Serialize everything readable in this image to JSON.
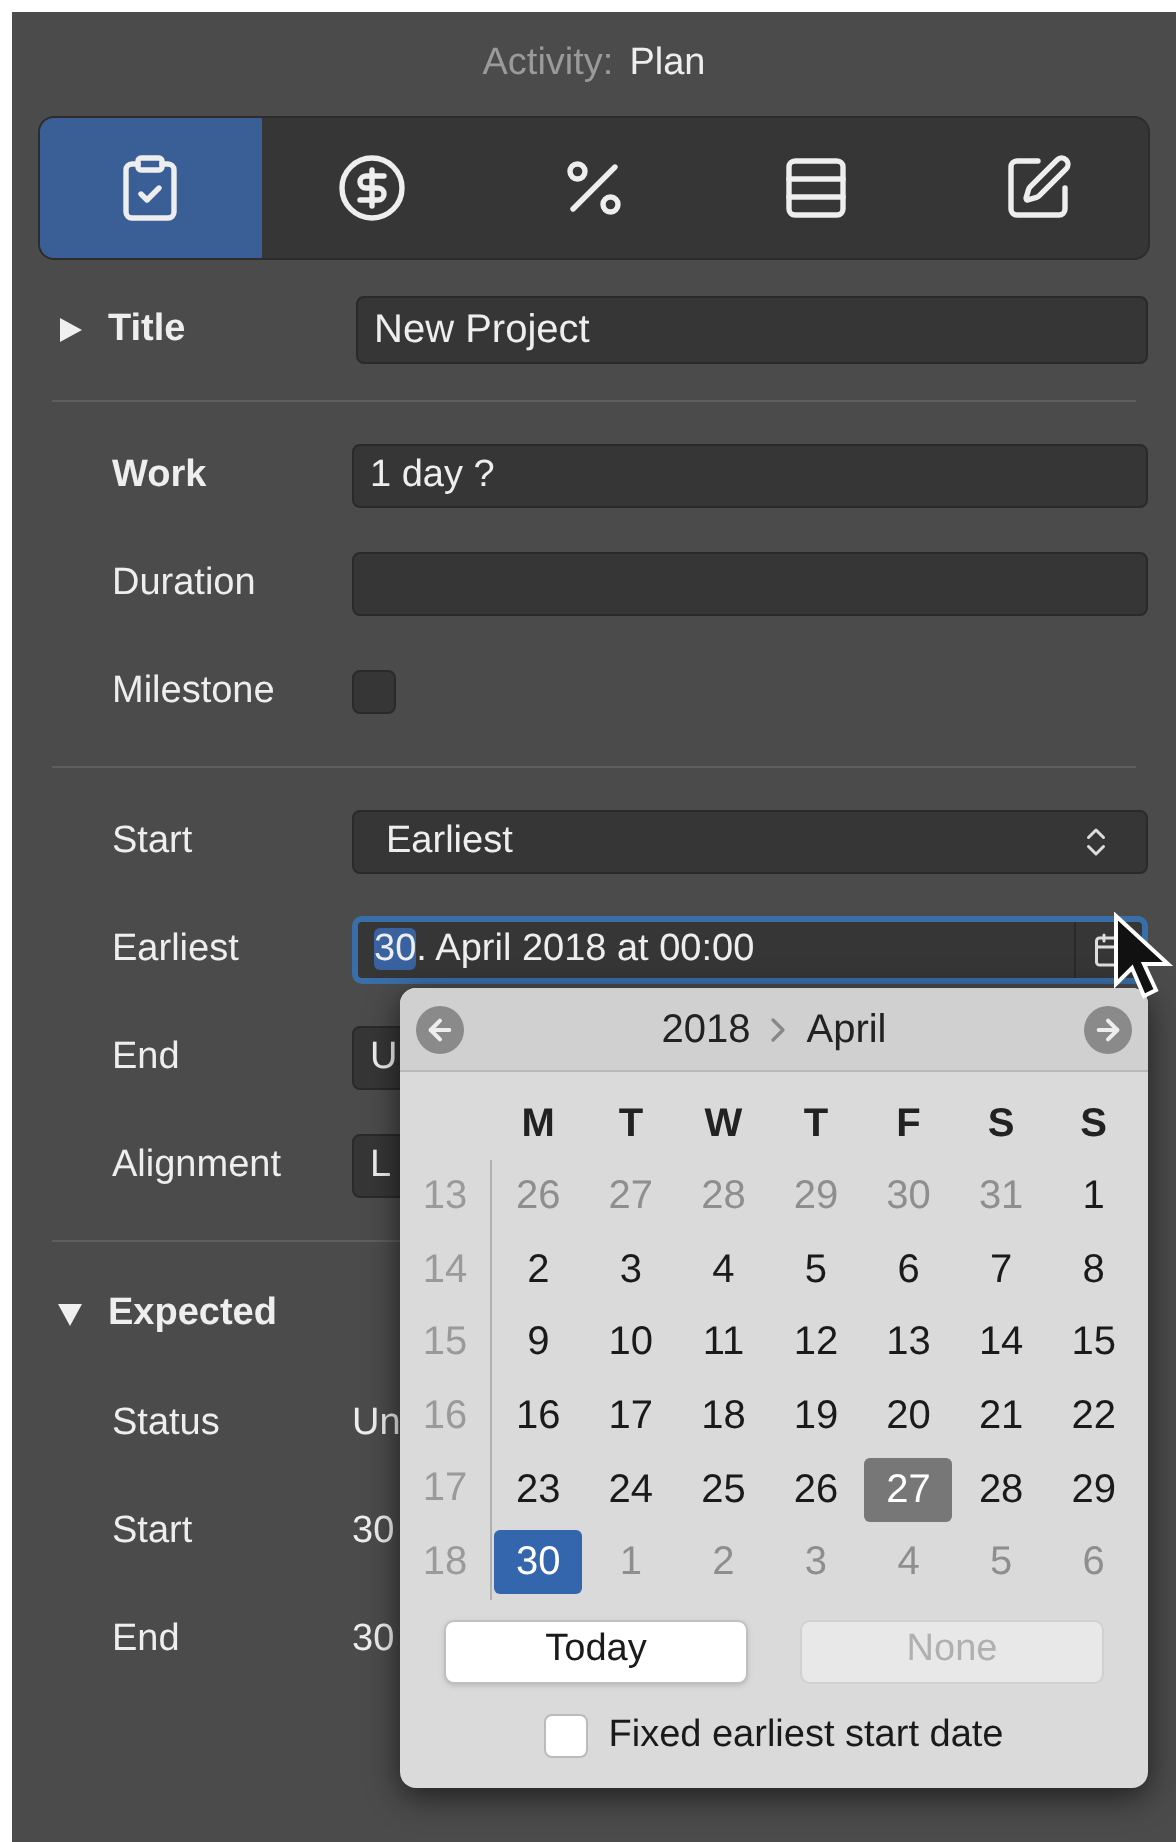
{
  "header": {
    "label": "Activity:",
    "value": "Plan"
  },
  "tabs": [
    {
      "kind": "task",
      "selected": true
    },
    {
      "kind": "cost",
      "selected": false
    },
    {
      "kind": "progress",
      "selected": false
    },
    {
      "kind": "resources",
      "selected": false
    },
    {
      "kind": "notes",
      "selected": false
    }
  ],
  "title_section": {
    "label": "Title",
    "expanded": false,
    "value": "New Project"
  },
  "work_fields": [
    {
      "kind": "text",
      "label": "Work",
      "emphasized": true,
      "value": "1 day ?"
    },
    {
      "kind": "text",
      "label": "Duration",
      "emphasized": false
    },
    {
      "kind": "checkbox",
      "label": "Milestone",
      "emphasized": false,
      "checked": false
    }
  ],
  "schedule_fields": [
    {
      "kind": "select",
      "label": "Start",
      "value": "Earliest"
    },
    {
      "kind": "date",
      "label": "Earliest",
      "selected_part": "30",
      "rest": ". April 2018 at 00:00",
      "focused": true
    },
    {
      "kind": "text",
      "label": "End",
      "value": "U"
    },
    {
      "kind": "text",
      "label": "Alignment",
      "value": "L"
    }
  ],
  "expected": {
    "label": "Expected",
    "expanded": true,
    "rows": [
      {
        "label": "Status",
        "value": "Un"
      },
      {
        "label": "Start",
        "value": "30"
      },
      {
        "label": "End",
        "value": "30"
      }
    ]
  },
  "calendar": {
    "year": "2018",
    "month": "April",
    "weekdays": [
      "M",
      "T",
      "W",
      "T",
      "F",
      "S",
      "S"
    ],
    "weeks": [
      {
        "number": "13",
        "days": [
          {
            "label": "26",
            "in_month": false,
            "selected": false,
            "today": false
          },
          {
            "label": "27",
            "in_month": false,
            "selected": false,
            "today": false
          },
          {
            "label": "28",
            "in_month": false,
            "selected": false,
            "today": false
          },
          {
            "label": "29",
            "in_month": false,
            "selected": false,
            "today": false
          },
          {
            "label": "30",
            "in_month": false,
            "selected": false,
            "today": false
          },
          {
            "label": "31",
            "in_month": false,
            "selected": false,
            "today": false
          },
          {
            "label": "1",
            "in_month": true,
            "selected": false,
            "today": false
          }
        ]
      },
      {
        "number": "14",
        "days": [
          {
            "label": "2",
            "in_month": true,
            "selected": false,
            "today": false
          },
          {
            "label": "3",
            "in_month": true,
            "selected": false,
            "today": false
          },
          {
            "label": "4",
            "in_month": true,
            "selected": false,
            "today": false
          },
          {
            "label": "5",
            "in_month": true,
            "selected": false,
            "today": false
          },
          {
            "label": "6",
            "in_month": true,
            "selected": false,
            "today": false
          },
          {
            "label": "7",
            "in_month": true,
            "selected": false,
            "today": false
          },
          {
            "label": "8",
            "in_month": true,
            "selected": false,
            "today": false
          }
        ]
      },
      {
        "number": "15",
        "days": [
          {
            "label": "9",
            "in_month": true,
            "selected": false,
            "today": false
          },
          {
            "label": "10",
            "in_month": true,
            "selected": false,
            "today": false
          },
          {
            "label": "11",
            "in_month": true,
            "selected": false,
            "today": false
          },
          {
            "label": "12",
            "in_month": true,
            "selected": false,
            "today": false
          },
          {
            "label": "13",
            "in_month": true,
            "selected": false,
            "today": false
          },
          {
            "label": "14",
            "in_month": true,
            "selected": false,
            "today": false
          },
          {
            "label": "15",
            "in_month": true,
            "selected": false,
            "today": false
          }
        ]
      },
      {
        "number": "16",
        "days": [
          {
            "label": "16",
            "in_month": true,
            "selected": false,
            "today": false
          },
          {
            "label": "17",
            "in_month": true,
            "selected": false,
            "today": false
          },
          {
            "label": "18",
            "in_month": true,
            "selected": false,
            "today": false
          },
          {
            "label": "19",
            "in_month": true,
            "selected": false,
            "today": false
          },
          {
            "label": "20",
            "in_month": true,
            "selected": false,
            "today": false
          },
          {
            "label": "21",
            "in_month": true,
            "selected": false,
            "today": false
          },
          {
            "label": "22",
            "in_month": true,
            "selected": false,
            "today": false
          }
        ]
      },
      {
        "number": "17",
        "days": [
          {
            "label": "23",
            "in_month": true,
            "selected": false,
            "today": false
          },
          {
            "label": "24",
            "in_month": true,
            "selected": false,
            "today": false
          },
          {
            "label": "25",
            "in_month": true,
            "selected": false,
            "today": false
          },
          {
            "label": "26",
            "in_month": true,
            "selected": false,
            "today": false
          },
          {
            "label": "27",
            "in_month": true,
            "selected": false,
            "today": true
          },
          {
            "label": "28",
            "in_month": true,
            "selected": false,
            "today": false
          },
          {
            "label": "29",
            "in_month": true,
            "selected": false,
            "today": false
          }
        ]
      },
      {
        "number": "18",
        "days": [
          {
            "label": "30",
            "in_month": true,
            "selected": true,
            "today": false
          },
          {
            "label": "1",
            "in_month": false,
            "selected": false,
            "today": false
          },
          {
            "label": "2",
            "in_month": false,
            "selected": false,
            "today": false
          },
          {
            "label": "3",
            "in_month": false,
            "selected": false,
            "today": false
          },
          {
            "label": "4",
            "in_month": false,
            "selected": false,
            "today": false
          },
          {
            "label": "5",
            "in_month": false,
            "selected": false,
            "today": false
          },
          {
            "label": "6",
            "in_month": false,
            "selected": false,
            "today": false
          }
        ]
      }
    ],
    "buttons": [
      {
        "label": "Today",
        "disabled": false
      },
      {
        "label": "None",
        "disabled": true
      }
    ],
    "fixed": {
      "label": "Fixed earliest start date",
      "checked": false
    }
  }
}
